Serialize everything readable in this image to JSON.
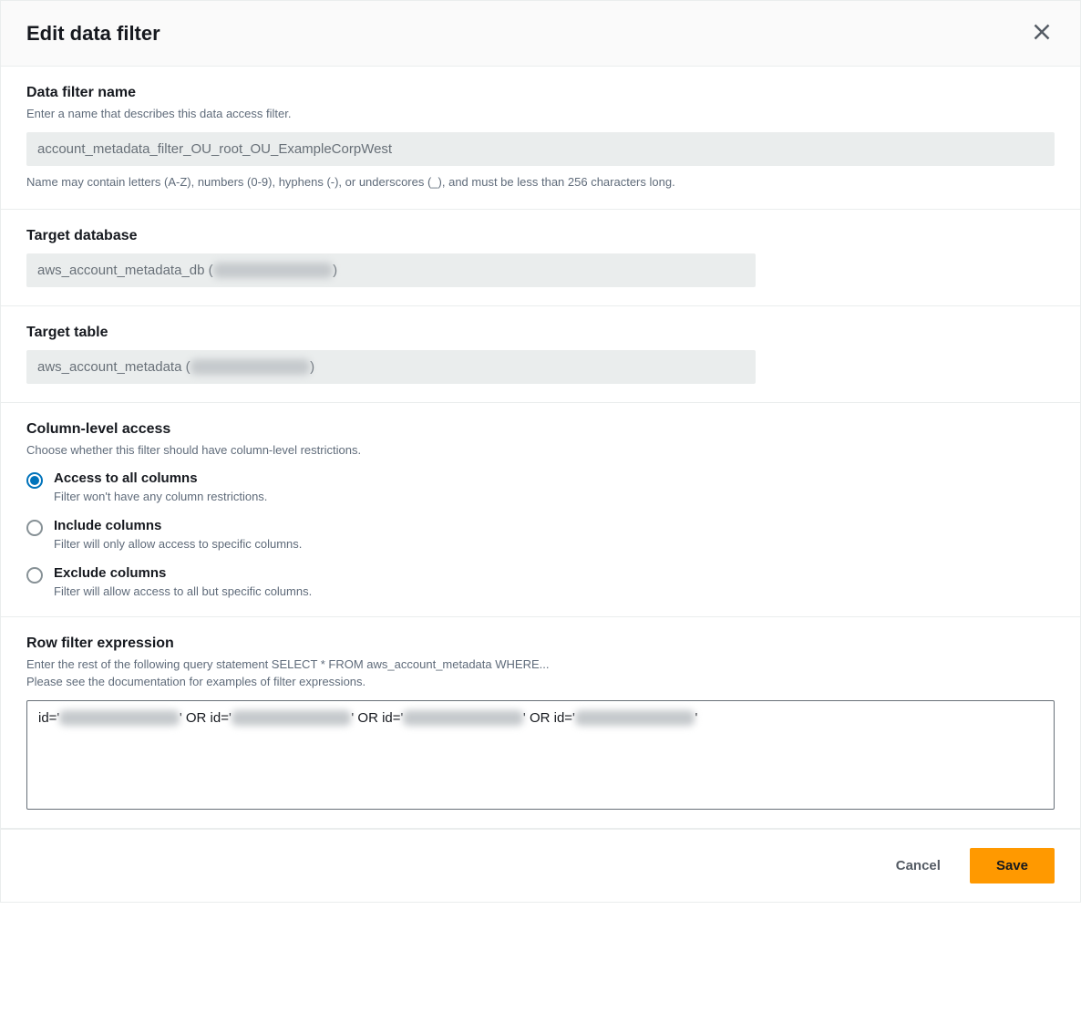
{
  "header": {
    "title": "Edit data filter"
  },
  "filterName": {
    "label": "Data filter name",
    "help": "Enter a name that describes this data access filter.",
    "value": "account_metadata_filter_OU_root_OU_ExampleCorpWest",
    "hint": "Name may contain letters (A-Z), numbers (0-9), hyphens (-), or underscores (_), and must be less than 256 characters long."
  },
  "targetDatabase": {
    "label": "Target database",
    "valuePrefix": "aws_account_metadata_db (",
    "valueRedacted": "████████████",
    "valueSuffix": ")"
  },
  "targetTable": {
    "label": "Target table",
    "valuePrefix": "aws_account_metadata (",
    "valueRedacted": "████████████",
    "valueSuffix": ")"
  },
  "columnAccess": {
    "label": "Column-level access",
    "help": "Choose whether this filter should have column-level restrictions.",
    "options": [
      {
        "label": "Access to all columns",
        "desc": "Filter won't have any column restrictions.",
        "checked": true
      },
      {
        "label": "Include columns",
        "desc": "Filter will only allow access to specific columns.",
        "checked": false
      },
      {
        "label": "Exclude columns",
        "desc": "Filter will allow access to all but specific columns.",
        "checked": false
      }
    ]
  },
  "rowFilter": {
    "label": "Row filter expression",
    "help1": "Enter the rest of the following query statement SELECT * FROM aws_account_metadata WHERE...",
    "help2": "Please see the documentation for examples of filter expressions.",
    "expr": {
      "p0": "id='",
      "r0": "████████████",
      "p1": "' OR id='",
      "r1": "████████████",
      "p2": "' OR id='",
      "r2": "████████████",
      "p3": "' OR id='",
      "r3": "████████████",
      "p4": "'"
    }
  },
  "footer": {
    "cancel": "Cancel",
    "save": "Save"
  }
}
